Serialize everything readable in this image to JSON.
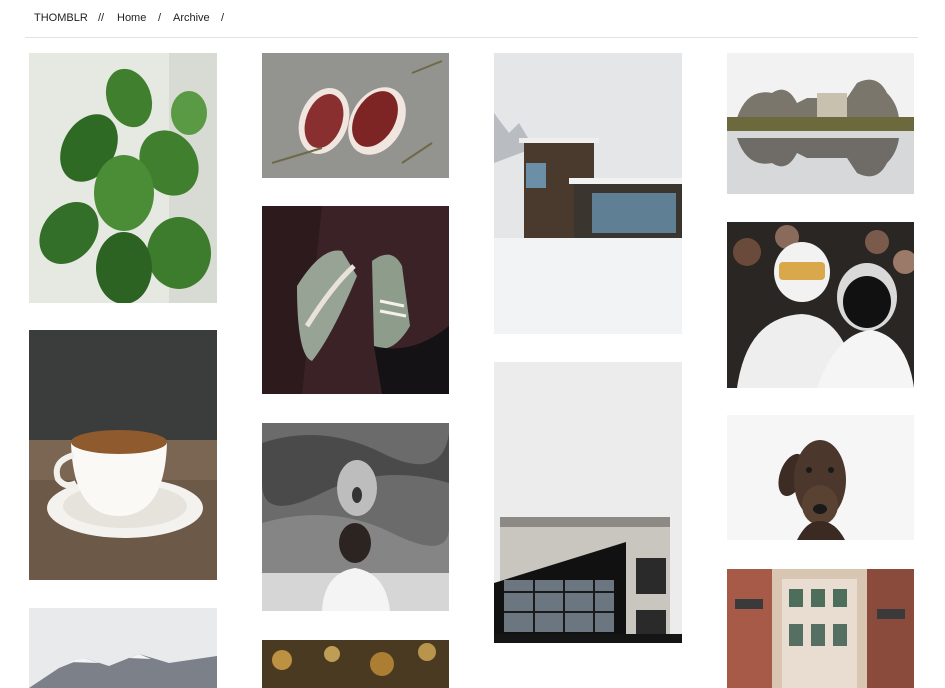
{
  "nav": {
    "brand": "THOMBLR",
    "sep1": "//",
    "home": "Home",
    "sep2": "/",
    "archive": "Archive",
    "sep3": "/"
  },
  "photos": [
    {
      "subject": "fiddle-leaf fig plant"
    },
    {
      "subject": "two raw steaks on concrete"
    },
    {
      "subject": "modern house in snow"
    },
    {
      "subject": "rock house reflected in water"
    },
    {
      "subject": "sneakers on wooden floor"
    },
    {
      "subject": "Daft Punk at award show"
    },
    {
      "subject": "coffee cup on saucer"
    },
    {
      "subject": "The Scream with man covering face"
    },
    {
      "subject": "modern building against white sky"
    },
    {
      "subject": "dog portrait on white"
    },
    {
      "subject": "snowy mountain"
    },
    {
      "subject": "bokeh lights"
    },
    {
      "subject": "venice street facades"
    }
  ]
}
